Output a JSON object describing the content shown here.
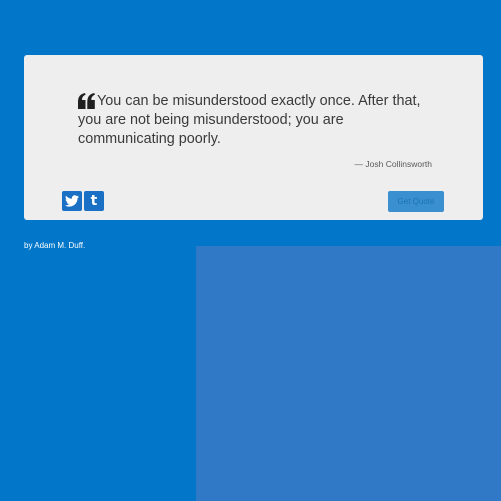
{
  "colors": {
    "background": "#0277c9",
    "panel": "#3079c6",
    "card": "#eeeeee",
    "accent": "#1a70c4"
  },
  "quote": {
    "text": "You can be misunderstood exactly once. After that, you are not being misunderstood; you are communicating poorly.",
    "author": "— Josh Collinsworth",
    "icon": "quote-left-icon"
  },
  "social": {
    "twitter_icon": "twitter-icon",
    "tumblr_icon": "tumblr-icon",
    "tumblr_glyph": "t"
  },
  "actions": {
    "new_quote_label": "Get Quote"
  },
  "footer": {
    "byline": "by Adam M. Duff."
  }
}
